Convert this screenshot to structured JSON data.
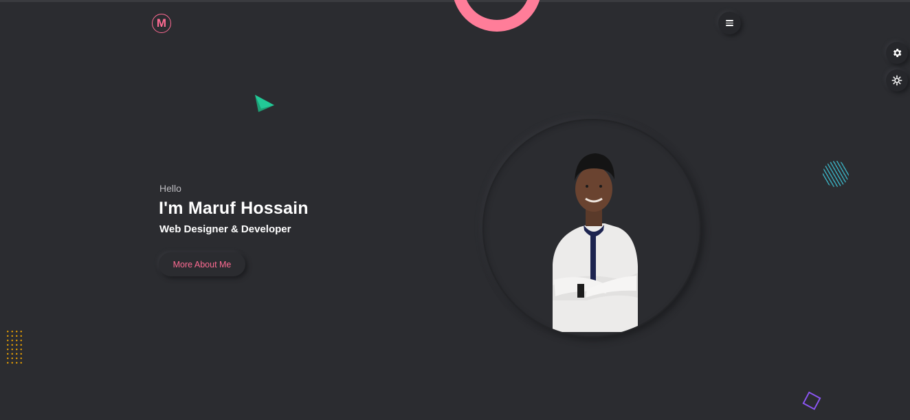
{
  "header": {
    "logo_letter": "M",
    "menu_icon": "hamburger-menu-icon"
  },
  "sidebar": {
    "settings_icon": "gear-icon",
    "theme_icon": "sun-gear-icon"
  },
  "hero": {
    "greeting": "Hello",
    "name": "I'm Maruf Hossain",
    "role": "Web Designer & Developer",
    "cta_label": "More About Me"
  },
  "portrait": {
    "description_icon": "portrait-photo"
  },
  "colors": {
    "background": "#2b2c30",
    "accent_pink": "#ff6b93",
    "triangle_green": "#20c997",
    "dots_orange": "#f0a500",
    "stripes_teal": "#3aa9b9",
    "square_purple": "#8b55f2"
  }
}
